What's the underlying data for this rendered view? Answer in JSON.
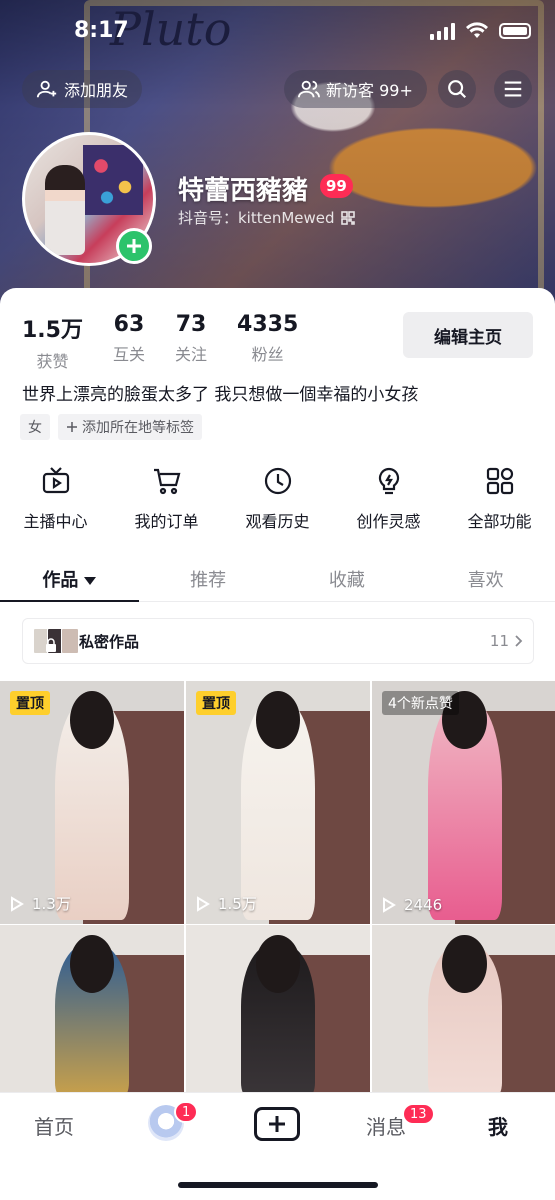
{
  "status_bar": {
    "time": "8:17"
  },
  "banner": {
    "logo_text": "Pluto"
  },
  "header": {
    "add_friend_label": "添加朋友",
    "visitors_label": "新访客 99+"
  },
  "profile": {
    "nickname": "特蕾西豬豬",
    "level": "99",
    "douyin_id": "抖音号：kittenMewed"
  },
  "stats": [
    {
      "value": "1.5万",
      "label": "获赞"
    },
    {
      "value": "63",
      "label": "互关"
    },
    {
      "value": "73",
      "label": "关注"
    },
    {
      "value": "4335",
      "label": "粉丝"
    }
  ],
  "edit_button": "编辑主页",
  "bio": "世界上漂亮的臉蛋太多了 我只想做一個幸福的小女孩",
  "tags": {
    "gender": "女",
    "add_location": "添加所在地等标签"
  },
  "tools": [
    {
      "label": "主播中心",
      "icon": "tv-icon"
    },
    {
      "label": "我的订单",
      "icon": "cart-icon"
    },
    {
      "label": "观看历史",
      "icon": "clock-icon"
    },
    {
      "label": "创作灵感",
      "icon": "bulb-icon"
    },
    {
      "label": "全部功能",
      "icon": "apps-icon"
    }
  ],
  "tabs": [
    {
      "label": "作品"
    },
    {
      "label": "推荐"
    },
    {
      "label": "收藏"
    },
    {
      "label": "喜欢"
    }
  ],
  "private_works": {
    "label": "私密作品",
    "count": "11"
  },
  "videos": [
    {
      "badge": "置顶",
      "plays": "1.3万",
      "colors": [
        "#d9d6d3",
        "#f3eee9",
        "#e9cfc4"
      ]
    },
    {
      "badge": "置顶",
      "plays": "1.5万",
      "colors": [
        "#dedbd7",
        "#f6f3ee",
        "#efe6df"
      ]
    },
    {
      "badge": "4个新点赞",
      "plays": "2446",
      "colors": [
        "#d8d4d1",
        "#f0b8c4",
        "#e85d8f"
      ]
    },
    {
      "badge": "",
      "plays": "",
      "colors": [
        "#e6e2de",
        "#2f5d93",
        "#caa14a"
      ]
    },
    {
      "badge": "",
      "plays": "",
      "colors": [
        "#e9e5e1",
        "#1e1b1d",
        "#3a3538"
      ]
    },
    {
      "badge": "",
      "plays": "",
      "colors": [
        "#e4e0dc",
        "#e7c9c2",
        "#f2dcd6"
      ]
    }
  ],
  "bottom_nav": {
    "home": "首页",
    "friends_badge": "1",
    "messages": "消息",
    "messages_badge": "13",
    "me": "我"
  },
  "colors": {
    "accent": "#fe2c55",
    "pin_badge": "#fecf2c",
    "add_green": "#2cc36b"
  }
}
